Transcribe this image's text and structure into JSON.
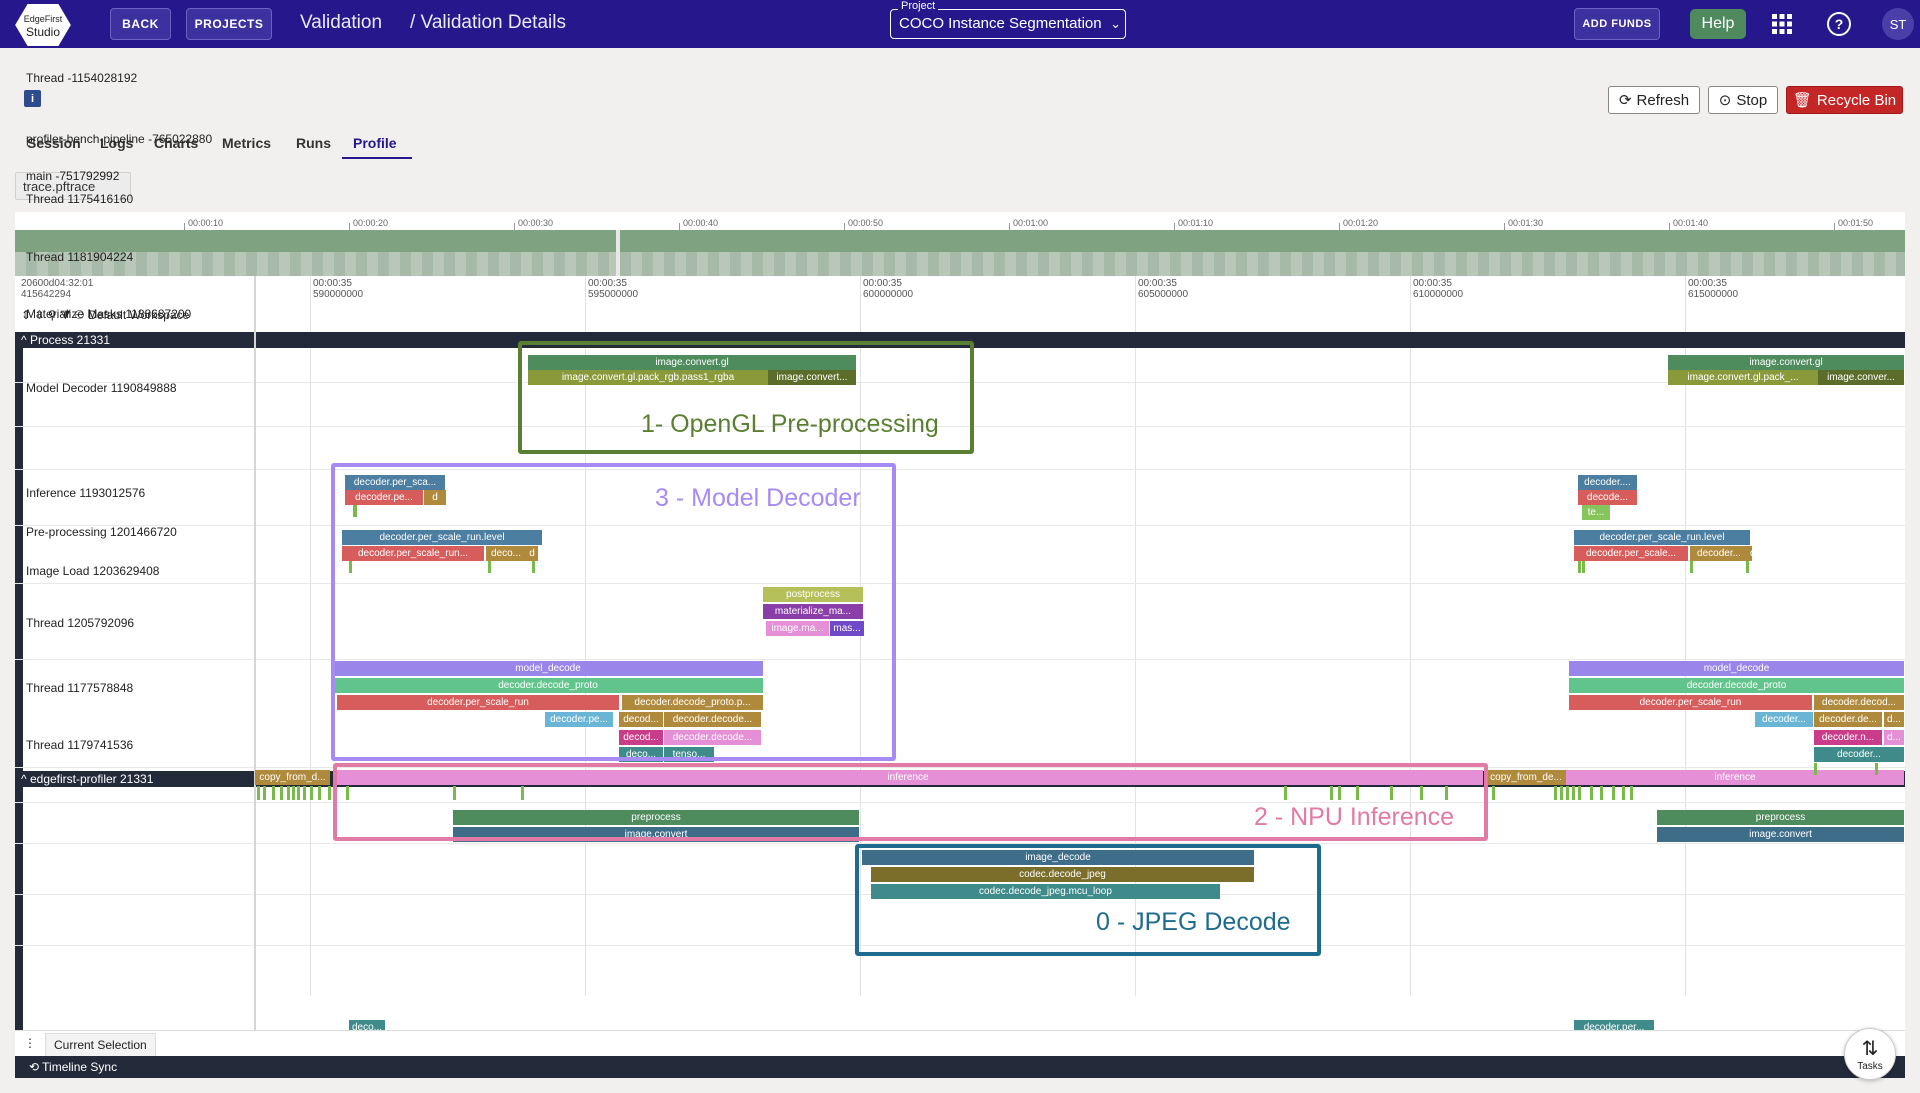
{
  "brand": {
    "line1": "EdgeFirst",
    "line2": "Studio"
  },
  "header": {
    "back": "BACK",
    "projects": "PROJECTS",
    "crumb1": "Validation",
    "crumb2": "/ Validation Details",
    "project_label": "Project",
    "project_value": "COCO Instance Segmentation",
    "add_funds": "ADD FUNDS",
    "help": "Help",
    "avatar": "ST"
  },
  "actions": {
    "refresh": "Refresh",
    "stop": "Stop",
    "recycle": "Recycle Bin"
  },
  "tabs": [
    "Session",
    "Logs",
    "Charts",
    "Metrics",
    "Runs",
    "Profile"
  ],
  "active_tab": "Profile",
  "trace_file": "trace.pftrace",
  "overview_ticks": [
    "00:00:10",
    "00:00:20",
    "00:00:30",
    "00:00:40",
    "00:00:50",
    "00:01:00",
    "00:01:10",
    "00:01:20",
    "00:01:30",
    "00:01:40",
    "00:01:50"
  ],
  "timeline_origin": {
    "line1": "20600d04:32:01",
    "line2": "415642294"
  },
  "timeline_ticks": [
    {
      "l1": "00:00:35",
      "l2": "590000000"
    },
    {
      "l1": "00:00:35",
      "l2": "595000000"
    },
    {
      "l1": "00:00:35",
      "l2": "600000000"
    },
    {
      "l1": "00:00:35",
      "l2": "605000000"
    },
    {
      "l1": "00:00:35",
      "l2": "610000000"
    },
    {
      "l1": "00:00:35",
      "l2": "615000000"
    }
  ],
  "workspace": "Default Workspace",
  "process1": "Process 21331",
  "process2": "edgefirst-profiler 21331",
  "threads": [
    "Thread -1154028192",
    "profiler-bench-pipeline -765022880",
    "main -751792992",
    "Thread 1175416160",
    "Thread 1181904224",
    "Materialize Masks 1188687200",
    "Model Decoder 1190849888",
    "Inference 1193012576",
    "Pre-processing 1201466720",
    "Image Load 1203629408",
    "Thread 1205792096",
    "Thread 1177578848",
    "Thread 1179741536"
  ],
  "slices": {
    "gl1": "image.convert.gl",
    "gl2": "image.convert.gl.pack_rgb.pass1_rgba",
    "gl3": "image.convert...",
    "gl1b": "image.convert.gl",
    "gl2b": "image.convert.gl.pack_...",
    "gl3b": "image.conver...",
    "d1a": "decoder.per_sca...",
    "d1b": "decoder.pe...",
    "d1c": "d",
    "d1d": "decoder....",
    "d1e": "decode...",
    "d1f": "te...",
    "d2a": "decoder.per_scale_run.level",
    "d2b": "decoder.per_scale_run...",
    "d2c": "deco...",
    "d2d": "d",
    "d2e": "decoder.per_scale_run.level",
    "d2f": "decoder.per_scale...",
    "d2g": "decoder...",
    "d2h": "d",
    "m1": "postprocess",
    "m2": "materialize_ma...",
    "m3": "image.ma...",
    "m4": "mas...",
    "md1": "model_decode",
    "md2": "decoder.decode_proto",
    "md3": "decoder.per_scale_run",
    "md4": "decoder.decode_proto.p...",
    "md5": "decoder.pe...",
    "md6": "decod...",
    "md7": "decoder.decode...",
    "md8": "decod...",
    "md9": "decoder.decode...",
    "md10": "deco...",
    "md11": "tenso...",
    "md1b": "model_decode",
    "md2b": "decoder.decode_proto",
    "md3b": "decoder.per_scale_run",
    "md4b": "decoder.decod...",
    "md5b": "decoder...",
    "md6b": "decoder.de...",
    "md7b": "d...",
    "md8b": "decoder.n...",
    "md9b": "d...",
    "md10b": "decoder...",
    "i1": "copy_from_d...",
    "i2": "inference",
    "i3": "copy_from_de...",
    "i4": "inference",
    "p1": "preprocess",
    "p2": "image.convert",
    "p3": "preprocess",
    "p4": "image.convert",
    "j1": "image_decode",
    "j2": "codec.decode_jpeg",
    "j3": "codec.decode_jpeg.mcu_loop",
    "t1": "deco...",
    "t2": "decoder.per..."
  },
  "annotations": {
    "a1": "1- OpenGL Pre-processing",
    "a3": "3 - Model Decoder",
    "a2": "2 - NPU Inference",
    "a0": "0 - JPEG Decode"
  },
  "bottom": {
    "current_selection": "Current Selection",
    "timeline_sync": "Timeline Sync",
    "tasks": "Tasks"
  },
  "colors": {
    "topbar": "#26178c",
    "opengl": "#5b7f32",
    "decoder": "#a78bf5",
    "npu": "#e27aa6",
    "jpeg": "#1f6b8e"
  }
}
